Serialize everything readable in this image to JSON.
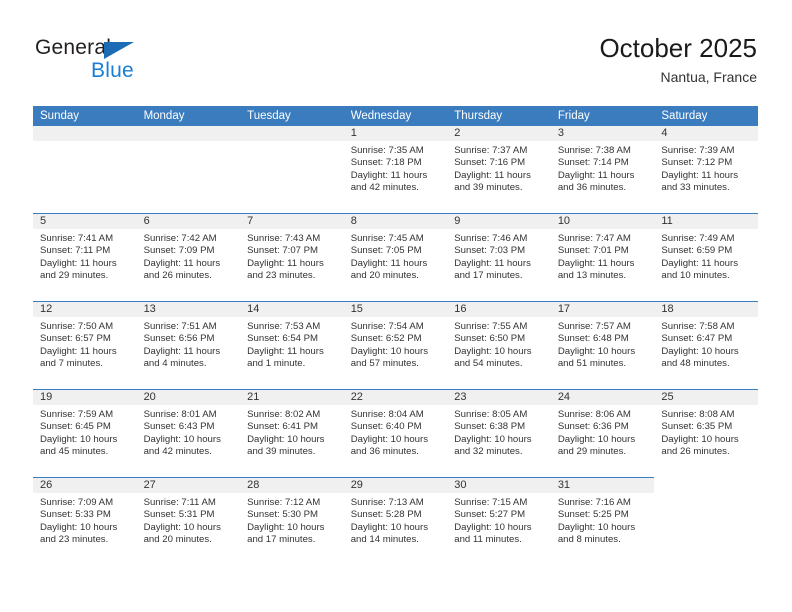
{
  "logo": {
    "line1": "General",
    "line2": "Blue",
    "triangle_color": "#1c6cb5",
    "blue_color": "#1a7fd4"
  },
  "header": {
    "title": "October 2025",
    "subtitle": "Nantua, France"
  },
  "theme": {
    "header_blue": "#3a7cbe",
    "daynum_gray": "#f0f0f0",
    "text": "#333333"
  },
  "weekday_headers": [
    "Sunday",
    "Monday",
    "Tuesday",
    "Wednesday",
    "Thursday",
    "Friday",
    "Saturday"
  ],
  "weeks": [
    [
      {
        "day": "",
        "lines": []
      },
      {
        "day": "",
        "lines": []
      },
      {
        "day": "",
        "lines": []
      },
      {
        "day": "1",
        "lines": [
          "Sunrise: 7:35 AM",
          "Sunset: 7:18 PM",
          "Daylight: 11 hours",
          "and 42 minutes."
        ]
      },
      {
        "day": "2",
        "lines": [
          "Sunrise: 7:37 AM",
          "Sunset: 7:16 PM",
          "Daylight: 11 hours",
          "and 39 minutes."
        ]
      },
      {
        "day": "3",
        "lines": [
          "Sunrise: 7:38 AM",
          "Sunset: 7:14 PM",
          "Daylight: 11 hours",
          "and 36 minutes."
        ]
      },
      {
        "day": "4",
        "lines": [
          "Sunrise: 7:39 AM",
          "Sunset: 7:12 PM",
          "Daylight: 11 hours",
          "and 33 minutes."
        ]
      }
    ],
    [
      {
        "day": "5",
        "lines": [
          "Sunrise: 7:41 AM",
          "Sunset: 7:11 PM",
          "Daylight: 11 hours",
          "and 29 minutes."
        ]
      },
      {
        "day": "6",
        "lines": [
          "Sunrise: 7:42 AM",
          "Sunset: 7:09 PM",
          "Daylight: 11 hours",
          "and 26 minutes."
        ]
      },
      {
        "day": "7",
        "lines": [
          "Sunrise: 7:43 AM",
          "Sunset: 7:07 PM",
          "Daylight: 11 hours",
          "and 23 minutes."
        ]
      },
      {
        "day": "8",
        "lines": [
          "Sunrise: 7:45 AM",
          "Sunset: 7:05 PM",
          "Daylight: 11 hours",
          "and 20 minutes."
        ]
      },
      {
        "day": "9",
        "lines": [
          "Sunrise: 7:46 AM",
          "Sunset: 7:03 PM",
          "Daylight: 11 hours",
          "and 17 minutes."
        ]
      },
      {
        "day": "10",
        "lines": [
          "Sunrise: 7:47 AM",
          "Sunset: 7:01 PM",
          "Daylight: 11 hours",
          "and 13 minutes."
        ]
      },
      {
        "day": "11",
        "lines": [
          "Sunrise: 7:49 AM",
          "Sunset: 6:59 PM",
          "Daylight: 11 hours",
          "and 10 minutes."
        ]
      }
    ],
    [
      {
        "day": "12",
        "lines": [
          "Sunrise: 7:50 AM",
          "Sunset: 6:57 PM",
          "Daylight: 11 hours",
          "and 7 minutes."
        ]
      },
      {
        "day": "13",
        "lines": [
          "Sunrise: 7:51 AM",
          "Sunset: 6:56 PM",
          "Daylight: 11 hours",
          "and 4 minutes."
        ]
      },
      {
        "day": "14",
        "lines": [
          "Sunrise: 7:53 AM",
          "Sunset: 6:54 PM",
          "Daylight: 11 hours",
          "and 1 minute."
        ]
      },
      {
        "day": "15",
        "lines": [
          "Sunrise: 7:54 AM",
          "Sunset: 6:52 PM",
          "Daylight: 10 hours",
          "and 57 minutes."
        ]
      },
      {
        "day": "16",
        "lines": [
          "Sunrise: 7:55 AM",
          "Sunset: 6:50 PM",
          "Daylight: 10 hours",
          "and 54 minutes."
        ]
      },
      {
        "day": "17",
        "lines": [
          "Sunrise: 7:57 AM",
          "Sunset: 6:48 PM",
          "Daylight: 10 hours",
          "and 51 minutes."
        ]
      },
      {
        "day": "18",
        "lines": [
          "Sunrise: 7:58 AM",
          "Sunset: 6:47 PM",
          "Daylight: 10 hours",
          "and 48 minutes."
        ]
      }
    ],
    [
      {
        "day": "19",
        "lines": [
          "Sunrise: 7:59 AM",
          "Sunset: 6:45 PM",
          "Daylight: 10 hours",
          "and 45 minutes."
        ]
      },
      {
        "day": "20",
        "lines": [
          "Sunrise: 8:01 AM",
          "Sunset: 6:43 PM",
          "Daylight: 10 hours",
          "and 42 minutes."
        ]
      },
      {
        "day": "21",
        "lines": [
          "Sunrise: 8:02 AM",
          "Sunset: 6:41 PM",
          "Daylight: 10 hours",
          "and 39 minutes."
        ]
      },
      {
        "day": "22",
        "lines": [
          "Sunrise: 8:04 AM",
          "Sunset: 6:40 PM",
          "Daylight: 10 hours",
          "and 36 minutes."
        ]
      },
      {
        "day": "23",
        "lines": [
          "Sunrise: 8:05 AM",
          "Sunset: 6:38 PM",
          "Daylight: 10 hours",
          "and 32 minutes."
        ]
      },
      {
        "day": "24",
        "lines": [
          "Sunrise: 8:06 AM",
          "Sunset: 6:36 PM",
          "Daylight: 10 hours",
          "and 29 minutes."
        ]
      },
      {
        "day": "25",
        "lines": [
          "Sunrise: 8:08 AM",
          "Sunset: 6:35 PM",
          "Daylight: 10 hours",
          "and 26 minutes."
        ]
      }
    ],
    [
      {
        "day": "26",
        "lines": [
          "Sunrise: 7:09 AM",
          "Sunset: 5:33 PM",
          "Daylight: 10 hours",
          "and 23 minutes."
        ]
      },
      {
        "day": "27",
        "lines": [
          "Sunrise: 7:11 AM",
          "Sunset: 5:31 PM",
          "Daylight: 10 hours",
          "and 20 minutes."
        ]
      },
      {
        "day": "28",
        "lines": [
          "Sunrise: 7:12 AM",
          "Sunset: 5:30 PM",
          "Daylight: 10 hours",
          "and 17 minutes."
        ]
      },
      {
        "day": "29",
        "lines": [
          "Sunrise: 7:13 AM",
          "Sunset: 5:28 PM",
          "Daylight: 10 hours",
          "and 14 minutes."
        ]
      },
      {
        "day": "30",
        "lines": [
          "Sunrise: 7:15 AM",
          "Sunset: 5:27 PM",
          "Daylight: 10 hours",
          "and 11 minutes."
        ]
      },
      {
        "day": "31",
        "lines": [
          "Sunrise: 7:16 AM",
          "Sunset: 5:25 PM",
          "Daylight: 10 hours",
          "and 8 minutes."
        ]
      },
      {
        "day": "",
        "lines": []
      }
    ]
  ]
}
